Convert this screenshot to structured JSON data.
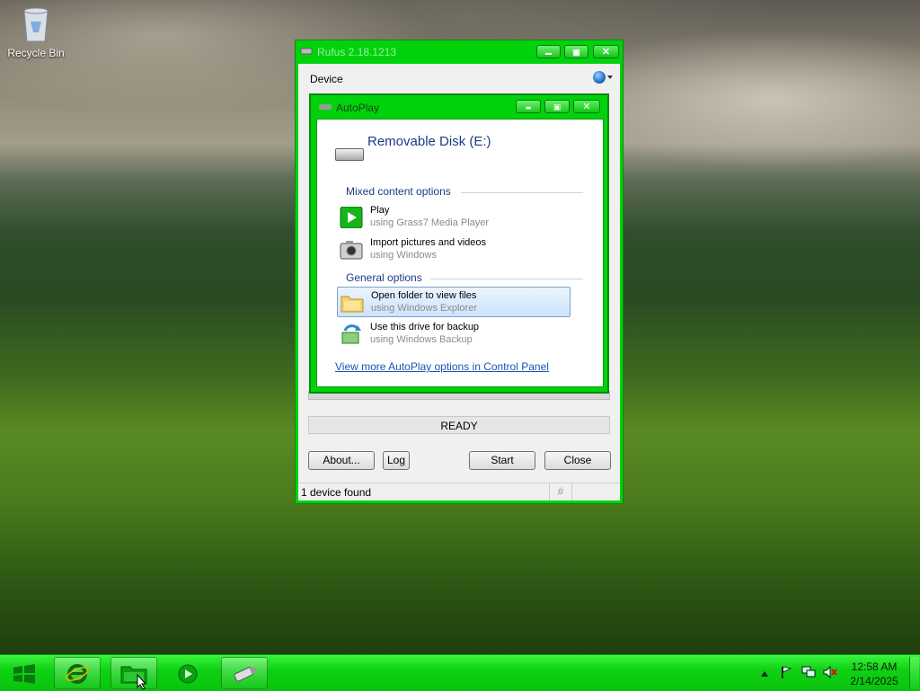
{
  "desktop": {
    "recycle_bin_label": "Recycle Bin"
  },
  "rufus": {
    "title": "Rufus 2.18.1213",
    "device_label": "Device",
    "status_text": "READY",
    "buttons": {
      "about": "About...",
      "log": "Log",
      "start": "Start",
      "close": "Close"
    },
    "statusbar_text": "1 device found",
    "statusbar_hash": "#",
    "window_controls": {
      "minimize": "▬",
      "maximize": "▣",
      "close": "✕"
    }
  },
  "autoplay": {
    "title": "AutoPlay",
    "drive_name": "Removable Disk (E:)",
    "sections": {
      "mixed": "Mixed content options",
      "general": "General options"
    },
    "options": [
      {
        "main": "Play",
        "sub": "using Grass7 Media Player",
        "icon": "play-icon"
      },
      {
        "main": "Import pictures and videos",
        "sub": "using Windows",
        "icon": "camera-icon"
      },
      {
        "main": "Open folder to view files",
        "sub": "using Windows Explorer",
        "icon": "folder-icon",
        "selected": true
      },
      {
        "main": "Use this drive for backup",
        "sub": "using Windows Backup",
        "icon": "backup-icon"
      }
    ],
    "more_link": "View more AutoPlay options in Control Panel",
    "window_controls": {
      "minimize": "▬",
      "maximize": "▣",
      "close": "✕"
    }
  },
  "taskbar": {
    "clock_time": "12:58 AM",
    "clock_date": "2/14/2025",
    "colors": {
      "taskbar": "#0fd214",
      "window_frame": "#00d20c"
    }
  }
}
